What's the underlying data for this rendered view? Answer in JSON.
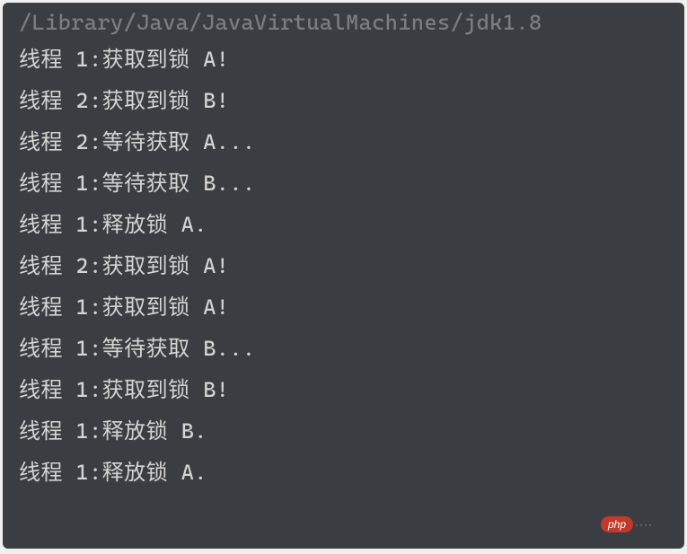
{
  "terminal": {
    "path": "/Library/Java/JavaVirtualMachines/jdk1.8",
    "lines": [
      "线程 1:获取到锁 A!",
      "线程 2:获取到锁 B!",
      "线程 2:等待获取 A...",
      "线程 1:等待获取 B...",
      "线程 1:释放锁 A.",
      "线程 2:获取到锁 A!",
      "线程 1:获取到锁 A!",
      "线程 1:等待获取 B...",
      "线程 1:获取到锁 B!",
      "线程 1:释放锁 B.",
      "线程 1:释放锁 A."
    ]
  },
  "watermark": {
    "badge": "php",
    "suffix": "····"
  }
}
